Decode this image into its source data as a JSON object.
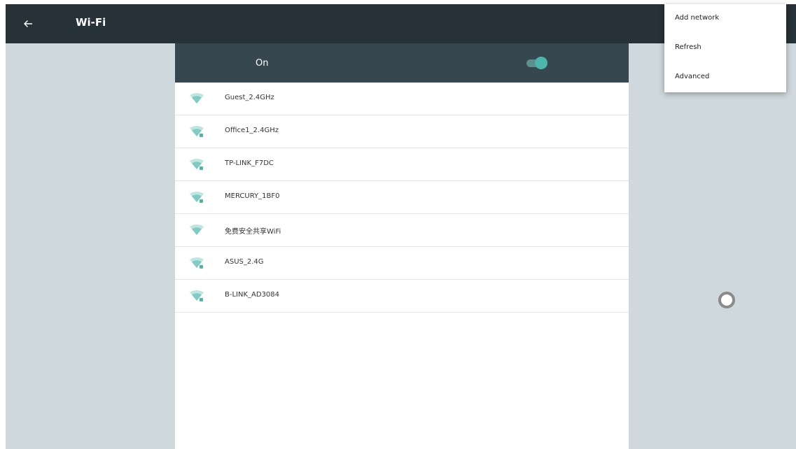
{
  "header": {
    "title": "Wi-Fi",
    "back_icon": "arrow-left-icon"
  },
  "wifi_switch": {
    "label": "On",
    "state": "on",
    "accent": "#4db6ac"
  },
  "networks": [
    {
      "ssid": "Guest_2.4GHz",
      "secured": false
    },
    {
      "ssid": "Office1_2.4GHz",
      "secured": true
    },
    {
      "ssid": "TP-LINK_F7DC",
      "secured": true
    },
    {
      "ssid": "MERCURY_1BF0",
      "secured": true
    },
    {
      "ssid": "免费安全共享WiFi",
      "secured": false
    },
    {
      "ssid": "ASUS_2.4G",
      "secured": true
    },
    {
      "ssid": "B-LINK_AD3084",
      "secured": true
    }
  ],
  "overflow_menu": {
    "items": [
      {
        "label": "Add network"
      },
      {
        "label": "Refresh"
      },
      {
        "label": "Advanced"
      }
    ]
  },
  "colors": {
    "topbar": "#263238",
    "onbar": "#37474f",
    "background": "#cfd8dc",
    "wifi_icon": "#80cbc4"
  }
}
